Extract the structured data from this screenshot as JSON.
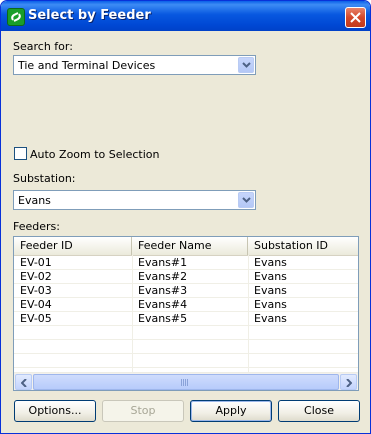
{
  "window": {
    "title": "Select by Feeder"
  },
  "search": {
    "label": "Search for:",
    "value": "Tie and Terminal Devices"
  },
  "auto_zoom": {
    "label": "Auto Zoom to Selection",
    "checked": false
  },
  "substation": {
    "label": "Substation:",
    "value": "Evans"
  },
  "feeders": {
    "label": "Feeders:",
    "columns": [
      "Feeder ID",
      "Feeder Name",
      "Substation ID"
    ],
    "rows": [
      [
        "EV-01",
        "Evans#1",
        "Evans"
      ],
      [
        "EV-02",
        "Evans#2",
        "Evans"
      ],
      [
        "EV-03",
        "Evans#3",
        "Evans"
      ],
      [
        "EV-04",
        "Evans#4",
        "Evans"
      ],
      [
        "EV-05",
        "Evans#5",
        "Evans"
      ]
    ]
  },
  "buttons": {
    "options": "Options...",
    "stop": "Stop",
    "apply": "Apply",
    "close": "Close"
  }
}
